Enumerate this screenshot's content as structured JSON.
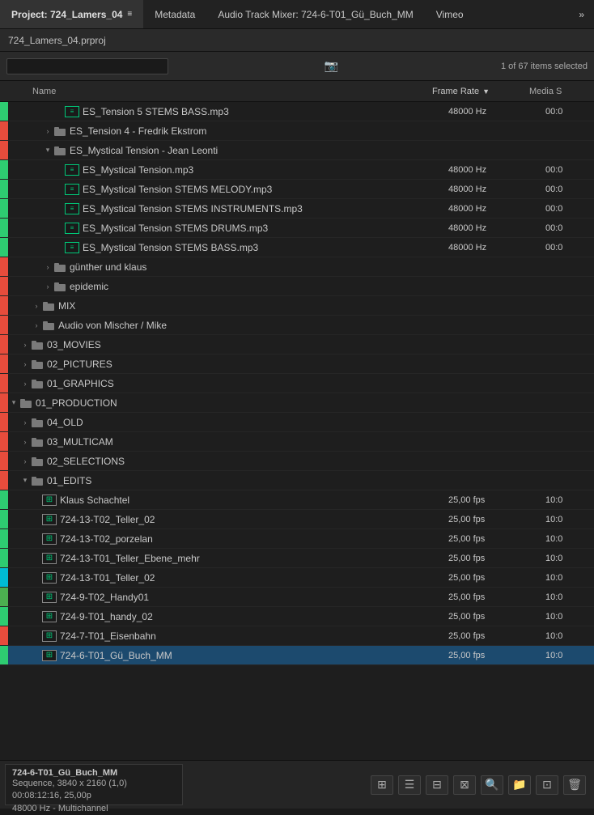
{
  "topbar": {
    "project_label": "Project: 724_Lamers_04",
    "menu_icon": "≡",
    "metadata_label": "Metadata",
    "audio_mixer_label": "Audio Track Mixer: 724-6-T01_Gü_Buch_MM",
    "vimeo_label": "Vimeo",
    "more_icon": "»"
  },
  "panel": {
    "title": "724_Lamers_04.prproj"
  },
  "search": {
    "placeholder": "",
    "count": "1 of 67 items selected"
  },
  "columns": {
    "name": "Name",
    "frame_rate": "Frame Rate",
    "media_start": "Media S"
  },
  "rows": [
    {
      "id": 1,
      "indent": 4,
      "type": "audio",
      "label": "ES_Tension 5 STEMS BASS.mp3",
      "framerate": "48000 Hz",
      "media": "00:0",
      "color": "#2ecc71",
      "expanded": null
    },
    {
      "id": 2,
      "indent": 3,
      "type": "folder",
      "label": "ES_Tension 4 - Fredrik Ekstrom",
      "framerate": "",
      "media": "",
      "color": "#e74c3c",
      "expanded": false
    },
    {
      "id": 3,
      "indent": 3,
      "type": "folder",
      "label": "ES_Mystical Tension - Jean Leonti",
      "framerate": "",
      "media": "",
      "color": "#e74c3c",
      "expanded": true
    },
    {
      "id": 4,
      "indent": 4,
      "type": "audio",
      "label": "ES_Mystical Tension.mp3",
      "framerate": "48000 Hz",
      "media": "00:0",
      "color": "#2ecc71",
      "expanded": null
    },
    {
      "id": 5,
      "indent": 4,
      "type": "audio",
      "label": "ES_Mystical Tension STEMS MELODY.mp3",
      "framerate": "48000 Hz",
      "media": "00:0",
      "color": "#2ecc71",
      "expanded": null
    },
    {
      "id": 6,
      "indent": 4,
      "type": "audio",
      "label": "ES_Mystical Tension STEMS INSTRUMENTS.mp3",
      "framerate": "48000 Hz",
      "media": "00:0",
      "color": "#2ecc71",
      "expanded": null
    },
    {
      "id": 7,
      "indent": 4,
      "type": "audio",
      "label": "ES_Mystical Tension STEMS DRUMS.mp3",
      "framerate": "48000 Hz",
      "media": "00:0",
      "color": "#2ecc71",
      "expanded": null
    },
    {
      "id": 8,
      "indent": 4,
      "type": "audio",
      "label": "ES_Mystical Tension STEMS BASS.mp3",
      "framerate": "48000 Hz",
      "media": "00:0",
      "color": "#2ecc71",
      "expanded": null
    },
    {
      "id": 9,
      "indent": 3,
      "type": "folder",
      "label": "günther und klaus",
      "framerate": "",
      "media": "",
      "color": "#e74c3c",
      "expanded": false
    },
    {
      "id": 10,
      "indent": 3,
      "type": "folder",
      "label": "epidemic",
      "framerate": "",
      "media": "",
      "color": "#e74c3c",
      "expanded": false
    },
    {
      "id": 11,
      "indent": 2,
      "type": "folder",
      "label": "MIX",
      "framerate": "",
      "media": "",
      "color": "#e74c3c",
      "expanded": false
    },
    {
      "id": 12,
      "indent": 2,
      "type": "folder",
      "label": "Audio von Mischer / Mike",
      "framerate": "",
      "media": "",
      "color": "#e74c3c",
      "expanded": false
    },
    {
      "id": 13,
      "indent": 1,
      "type": "folder",
      "label": "03_MOVIES",
      "framerate": "",
      "media": "",
      "color": "#e74c3c",
      "expanded": false
    },
    {
      "id": 14,
      "indent": 1,
      "type": "folder",
      "label": "02_PICTURES",
      "framerate": "",
      "media": "",
      "color": "#e74c3c",
      "expanded": false
    },
    {
      "id": 15,
      "indent": 1,
      "type": "folder",
      "label": "01_GRAPHICS",
      "framerate": "",
      "media": "",
      "color": "#e74c3c",
      "expanded": false
    },
    {
      "id": 16,
      "indent": 0,
      "type": "folder",
      "label": "01_PRODUCTION",
      "framerate": "",
      "media": "",
      "color": "#e74c3c",
      "expanded": true
    },
    {
      "id": 17,
      "indent": 1,
      "type": "folder",
      "label": "04_OLD",
      "framerate": "",
      "media": "",
      "color": "#e74c3c",
      "expanded": false
    },
    {
      "id": 18,
      "indent": 1,
      "type": "folder",
      "label": "03_MULTICAM",
      "framerate": "",
      "media": "",
      "color": "#e74c3c",
      "expanded": false
    },
    {
      "id": 19,
      "indent": 1,
      "type": "folder",
      "label": "02_SELECTIONS",
      "framerate": "",
      "media": "",
      "color": "#e74c3c",
      "expanded": false
    },
    {
      "id": 20,
      "indent": 1,
      "type": "folder",
      "label": "01_EDITS",
      "framerate": "",
      "media": "",
      "color": "#e74c3c",
      "expanded": true
    },
    {
      "id": 21,
      "indent": 2,
      "type": "sequence",
      "label": "Klaus Schachtel",
      "framerate": "25,00 fps",
      "media": "10:0",
      "color": "#2ecc71",
      "expanded": null
    },
    {
      "id": 22,
      "indent": 2,
      "type": "sequence",
      "label": "724-13-T02_Teller_02",
      "framerate": "25,00 fps",
      "media": "10:0",
      "color": "#2ecc71",
      "expanded": null
    },
    {
      "id": 23,
      "indent": 2,
      "type": "sequence",
      "label": "724-13-T02_porzelan",
      "framerate": "25,00 fps",
      "media": "10:0",
      "color": "#2ecc71",
      "expanded": null
    },
    {
      "id": 24,
      "indent": 2,
      "type": "sequence",
      "label": "724-13-T01_Teller_Ebene_mehr",
      "framerate": "25,00 fps",
      "media": "10:0",
      "color": "#2ecc71",
      "expanded": null
    },
    {
      "id": 25,
      "indent": 2,
      "type": "sequence",
      "label": "724-13-T01_Teller_02",
      "framerate": "25,00 fps",
      "media": "10:0",
      "color": "#00bcd4",
      "expanded": null
    },
    {
      "id": 26,
      "indent": 2,
      "type": "sequence",
      "label": "724-9-T02_Handy01",
      "framerate": "25,00 fps",
      "media": "10:0",
      "color": "#4caf50",
      "expanded": null
    },
    {
      "id": 27,
      "indent": 2,
      "type": "sequence",
      "label": "724-9-T01_handy_02",
      "framerate": "25,00 fps",
      "media": "10:0",
      "color": "#2ecc71",
      "expanded": null
    },
    {
      "id": 28,
      "indent": 2,
      "type": "sequence",
      "label": "724-7-T01_Eisenbahn",
      "framerate": "25,00 fps",
      "media": "10:0",
      "color": "#e74c3c",
      "expanded": null
    },
    {
      "id": 29,
      "indent": 2,
      "type": "sequence",
      "label": "724-6-T01_Gü_Buch_MM",
      "framerate": "25,00 fps",
      "media": "10:0",
      "color": "#2ecc71",
      "expanded": null,
      "selected": true
    }
  ],
  "bottom_info": {
    "title": "724-6-T01_Gü_Buch_MM",
    "line1": "Sequence, 3840 x 2160 (1,0)",
    "line2": "00:08:12:16, 25,00p",
    "line3": "48000 Hz - Multichannel"
  },
  "bottom_icons": {
    "grid_icon": "⊞",
    "list_icon": "☰",
    "thumb_icon": "⊟",
    "meta_icon": "⊠",
    "search_icon": "🔍",
    "folder_icon": "📁",
    "clip_icon": "⊡",
    "trash_icon": "🗑"
  }
}
